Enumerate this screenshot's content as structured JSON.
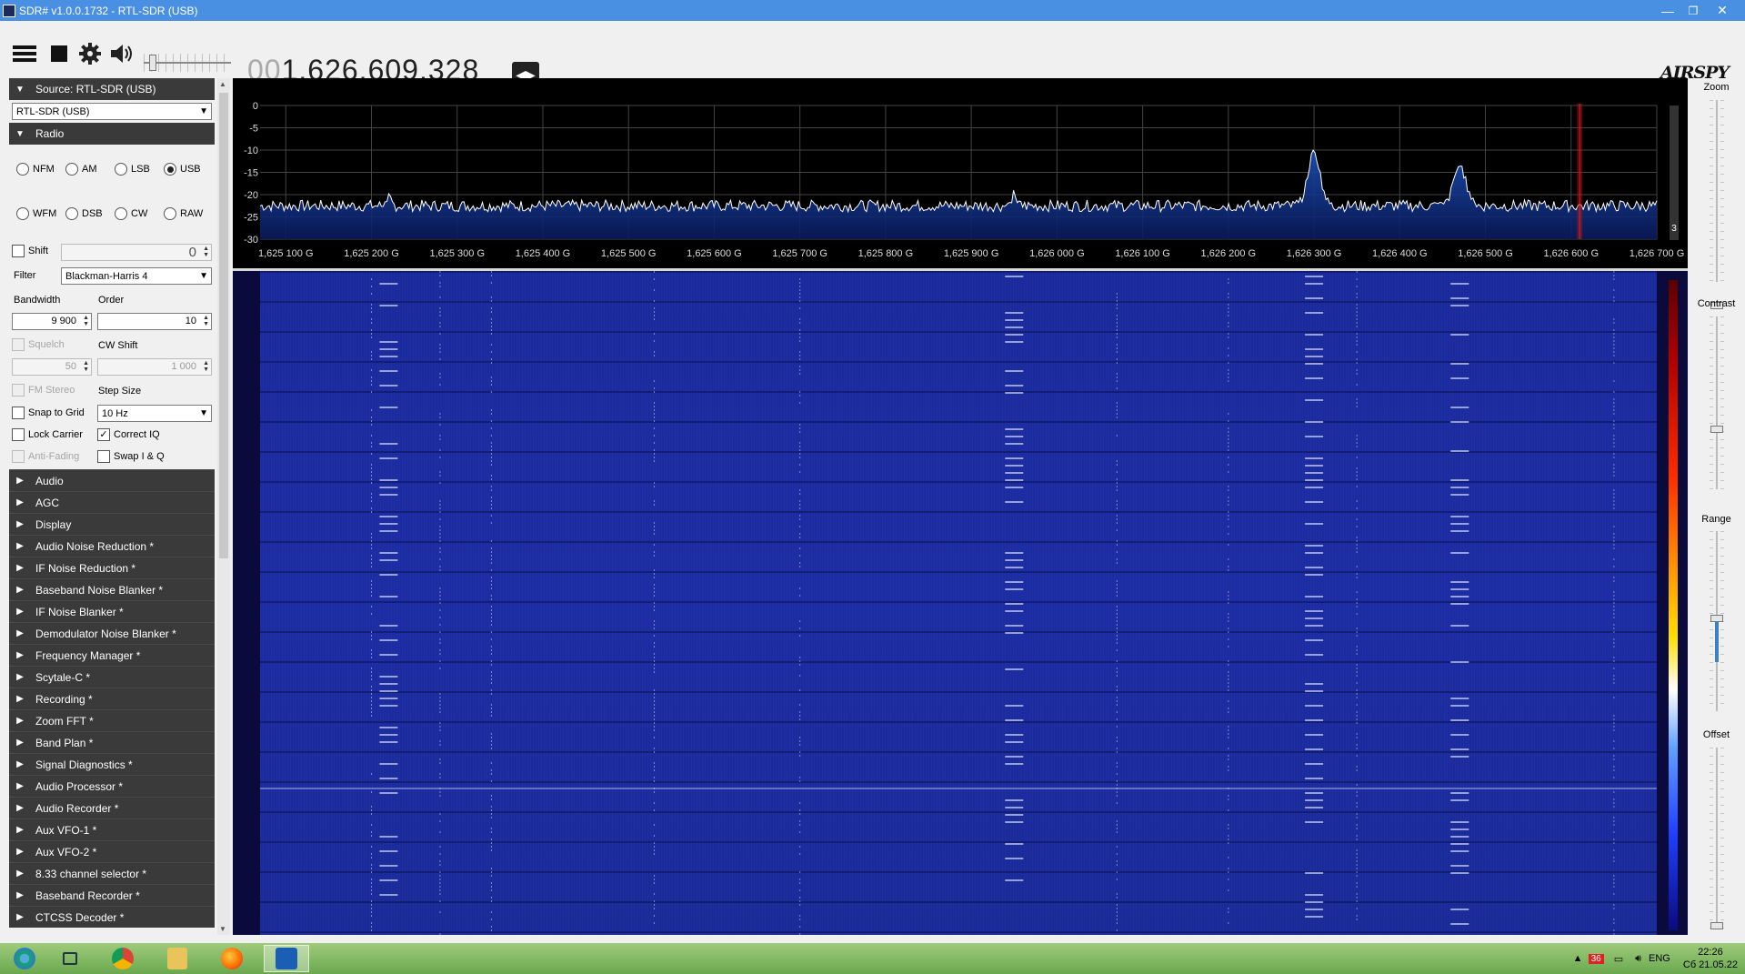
{
  "window": {
    "title": "SDR# v1.0.0.1732 - RTL-SDR (USB)",
    "minimize": "—",
    "restore": "❐",
    "close": "✕"
  },
  "toolbar": {
    "frequency_dim": "00",
    "frequency_main": "1.626.609.328",
    "logo": "AIRSPY",
    "volume_level": 0.08
  },
  "source": {
    "header": "Source: RTL-SDR (USB)",
    "device_selected": "RTL-SDR (USB)"
  },
  "radio": {
    "header": "Radio",
    "modes": [
      {
        "label": "NFM",
        "selected": false
      },
      {
        "label": "AM",
        "selected": false
      },
      {
        "label": "LSB",
        "selected": false
      },
      {
        "label": "USB",
        "selected": true
      },
      {
        "label": "WFM",
        "selected": false
      },
      {
        "label": "DSB",
        "selected": false
      },
      {
        "label": "CW",
        "selected": false
      },
      {
        "label": "RAW",
        "selected": false
      }
    ],
    "shift_label": "Shift",
    "shift_value": "0",
    "filter_label": "Filter",
    "filter_value": "Blackman-Harris 4",
    "bandwidth_label": "Bandwidth",
    "bandwidth_value": "9 900",
    "order_label": "Order",
    "order_value": "10",
    "squelch_label": "Squelch",
    "squelch_value": "50",
    "cw_shift_label": "CW Shift",
    "cw_shift_value": "1 000",
    "fm_stereo_label": "FM Stereo",
    "step_size_label": "Step Size",
    "snap_to_grid_label": "Snap to Grid",
    "step_size_value": "10 Hz",
    "lock_carrier_label": "Lock Carrier",
    "correct_iq_label": "Correct IQ",
    "correct_iq_checked": true,
    "anti_fading_label": "Anti-Fading",
    "swap_iq_label": "Swap I & Q"
  },
  "plugins": [
    "Audio",
    "AGC",
    "Display",
    "Audio Noise Reduction *",
    "IF Noise Reduction *",
    "Baseband Noise Blanker *",
    "IF Noise Blanker *",
    "Demodulator Noise Blanker *",
    "Frequency Manager *",
    "Scytale-C *",
    "Recording *",
    "Zoom FFT *",
    "Band Plan *",
    "Signal Diagnostics *",
    "Audio Processor *",
    "Audio Recorder *",
    "Aux VFO-1 *",
    "Aux VFO-2 *",
    "8.33 channel selector *",
    "Baseband Recorder *",
    "CTCSS Decoder *"
  ],
  "right_controls": {
    "zoom_label": "Zoom",
    "contrast_label": "Contrast",
    "range_label": "Range",
    "offset_label": "Offset"
  },
  "spectrum_badge": "3",
  "chart_data": {
    "type": "line",
    "x_ticks": [
      "1,625 100 G",
      "1,625 200 G",
      "1,625 300 G",
      "1,625 400 G",
      "1,625 500 G",
      "1,625 600 G",
      "1,625 700 G",
      "1,625 800 G",
      "1,625 900 G",
      "1,626 000 G",
      "1,626 100 G",
      "1,626 200 G",
      "1,626 300 G",
      "1,626 400 G",
      "1,626 500 G",
      "1,626 600 G",
      "1,626 700 G"
    ],
    "y_ticks": [
      "0",
      "-5",
      "-10",
      "-15",
      "-20",
      "-25",
      "-30"
    ],
    "ylim": [
      -30,
      0
    ],
    "xlim_ghz": [
      1.62507,
      1.6267
    ],
    "noise_floor_db": -22.5,
    "peaks": [
      {
        "x": 1.62522,
        "y": -20.5
      },
      {
        "x": 1.62595,
        "y": -19.5
      },
      {
        "x": 1.6263,
        "y": -10.5
      },
      {
        "x": 1.62647,
        "y": -13.5
      }
    ],
    "marker_x": 1.62661,
    "line_color": "#ffffff",
    "fill_color": "#1a4fb5",
    "grid": true
  },
  "taskbar": {
    "tray_badge": "36",
    "lang": "ENG",
    "time": "22:26",
    "date": "Сб 21.05.22"
  }
}
